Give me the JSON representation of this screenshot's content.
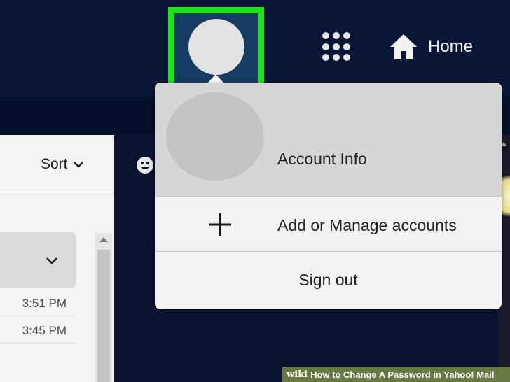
{
  "header": {
    "apps_icon": "apps-grid-icon",
    "home_label": "Home",
    "home_icon": "home-icon",
    "avatar_icon": "avatar-icon",
    "highlight_color": "#1fe01f"
  },
  "mail_list": {
    "sort_label": "Sort",
    "times": [
      "3:51 PM",
      "3:45 PM"
    ]
  },
  "account_menu": {
    "account_info_label": "Account Info",
    "add_manage_label": "Add or Manage accounts",
    "sign_out_label": "Sign out"
  },
  "caption": {
    "brand": "wiki",
    "text": "How to Change A Password in Yahoo! Mail"
  }
}
